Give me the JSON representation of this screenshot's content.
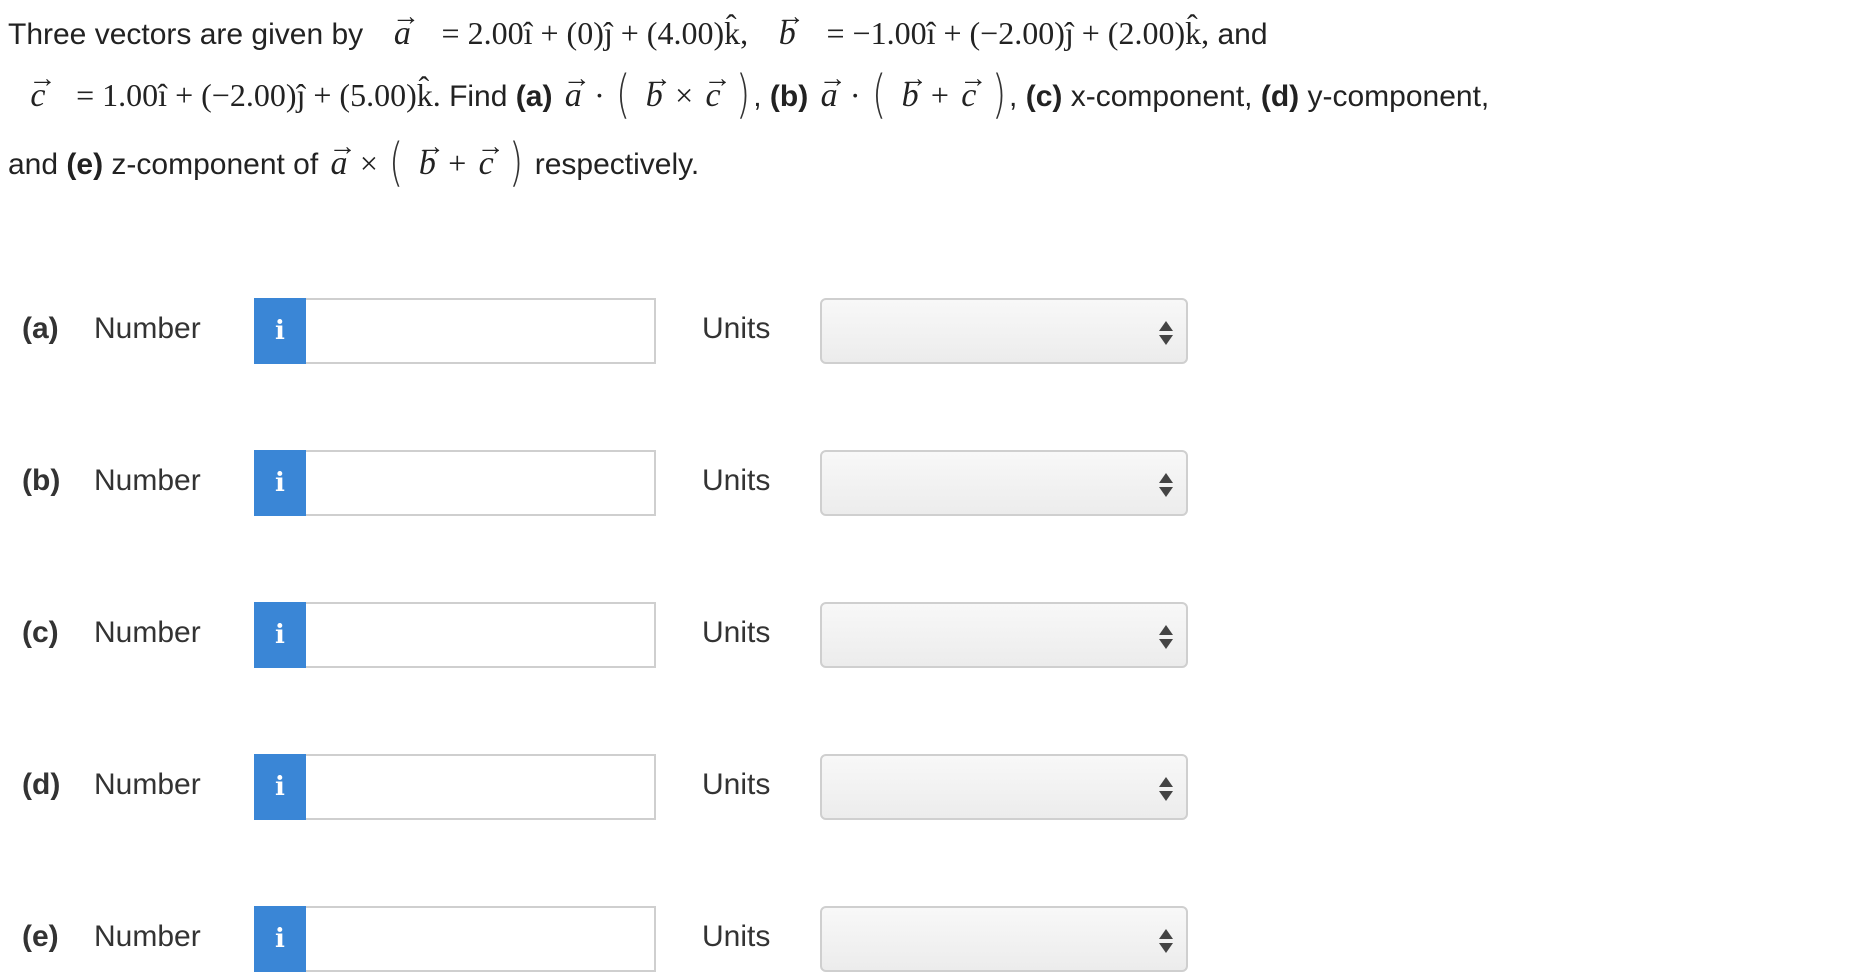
{
  "problem": {
    "intro": "Three vectors are given by",
    "vec_a_eq": "= 2.00î + (0)ĵ + (4.00)k̂,",
    "vec_b_eq": "= −1.00î + (−2.00)ĵ + (2.00)k̂,",
    "and": "and",
    "vec_c_eq": "= 1.00î + (−2.00)ĵ + (5.00)k̂.",
    "find": "Find",
    "part_a_tag": "(a)",
    "part_b_tag": "(b)",
    "part_c_tag": "(c)",
    "part_c_text": "x-component,",
    "part_d_tag": "(d)",
    "part_d_text": "y-component,",
    "and2": "and",
    "part_e_tag": "(e)",
    "part_e_text": "z-component of",
    "respectively": "respectively.",
    "sym_a": "a",
    "sym_b": "b",
    "sym_c": "c",
    "sym_arrow": "→",
    "sym_dot": "·",
    "sym_cross": "×",
    "sym_plus": "+",
    "sym_lparen": "(",
    "sym_rparen": ")",
    "comma": ","
  },
  "answers": [
    {
      "part": "(a)",
      "number_label": "Number",
      "info_glyph": "i",
      "value": "",
      "units_label": "Units",
      "units_selected": ""
    },
    {
      "part": "(b)",
      "number_label": "Number",
      "info_glyph": "i",
      "value": "",
      "units_label": "Units",
      "units_selected": ""
    },
    {
      "part": "(c)",
      "number_label": "Number",
      "info_glyph": "i",
      "value": "",
      "units_label": "Units",
      "units_selected": ""
    },
    {
      "part": "(d)",
      "number_label": "Number",
      "info_glyph": "i",
      "value": "",
      "units_label": "Units",
      "units_selected": ""
    },
    {
      "part": "(e)",
      "number_label": "Number",
      "info_glyph": "i",
      "value": "",
      "units_label": "Units",
      "units_selected": ""
    }
  ],
  "colors": {
    "info_button": "#3a86d6",
    "border": "#cfcfcf",
    "text": "#333333"
  },
  "icons": {
    "info": "info-icon",
    "select_arrows": "up-down-arrows-icon"
  }
}
